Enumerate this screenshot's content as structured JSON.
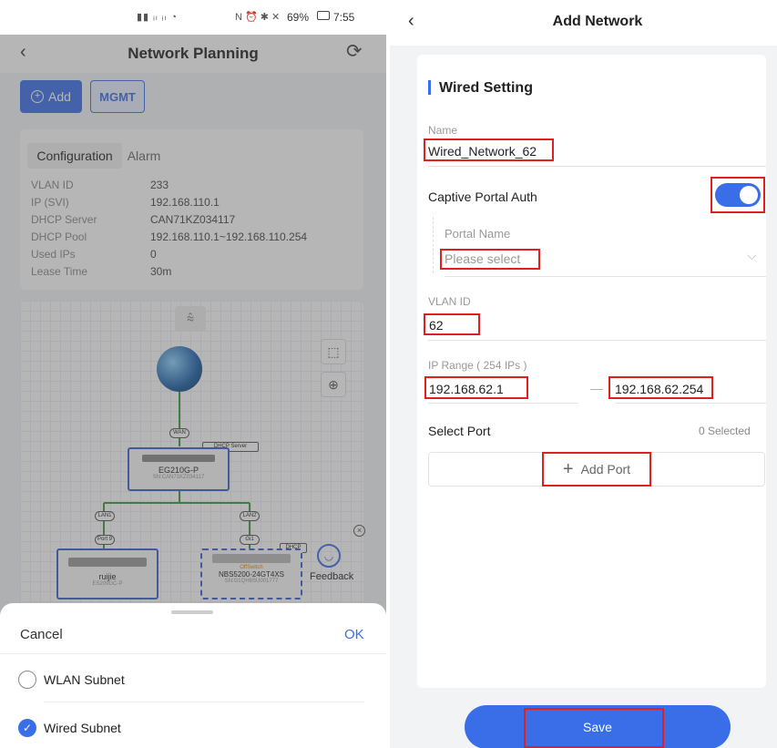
{
  "status_bar": {
    "battery": "69%",
    "time": "7:55"
  },
  "left": {
    "nav": {
      "title": "Network Planning"
    },
    "toolbar": {
      "add_label": "Add",
      "mgmt_label": "MGMT"
    },
    "tabs": [
      {
        "label": "Configuration"
      },
      {
        "label": "Alarm"
      }
    ],
    "config": [
      {
        "key": "VLAN ID",
        "value": "233"
      },
      {
        "key": "IP (SVI)",
        "value": "192.168.110.1"
      },
      {
        "key": "DHCP Server",
        "value": "CAN71KZ034117"
      },
      {
        "key": "DHCP Pool",
        "value": "192.168.110.1~192.168.110.254"
      },
      {
        "key": "Used IPs",
        "value": "0"
      },
      {
        "key": "Lease Time",
        "value": "30m"
      }
    ],
    "topology": {
      "wan_label": "WAN",
      "dhcp_badge": "DHCP Server",
      "gateway": {
        "model": "EG210G-P",
        "sn": "SN:CAN71KZ034117"
      },
      "lan_left": "LAN1",
      "lan_right": "LAN2",
      "port_left": "Port 9",
      "port_right": "Gi1",
      "switch_left": {
        "name": "ruijie",
        "model": "ES209GC-P"
      },
      "switch_right": {
        "status": "OffSwitch",
        "model": "NBS5200-24GT4XS",
        "sn": "SN:G1QH8SU001777",
        "badge": "DHCP"
      },
      "feedback_label": "Feedback"
    },
    "sheet": {
      "cancel": "Cancel",
      "ok": "OK",
      "options": [
        {
          "label": "WLAN Subnet",
          "selected": false
        },
        {
          "label": "Wired Subnet",
          "selected": true
        }
      ]
    }
  },
  "right": {
    "nav": {
      "title": "Add Network"
    },
    "section_title": "Wired Setting",
    "name": {
      "label": "Name",
      "value": "Wired_Network_62"
    },
    "captive": {
      "label": "Captive Portal Auth",
      "enabled": true
    },
    "portal": {
      "label": "Portal Name",
      "placeholder": "Please select"
    },
    "vlan": {
      "label": "VLAN ID",
      "value": "62"
    },
    "ip_range": {
      "label": "IP Range ( 254  IPs )",
      "start": "192.168.62.1",
      "separator": "—",
      "end": "192.168.62.254"
    },
    "port": {
      "label": "Select Port",
      "count": "0 Selected",
      "add_label": "Add Port"
    },
    "save_label": "Save"
  },
  "colors": {
    "accent": "#3a6ee8",
    "highlight": "#e02020"
  }
}
